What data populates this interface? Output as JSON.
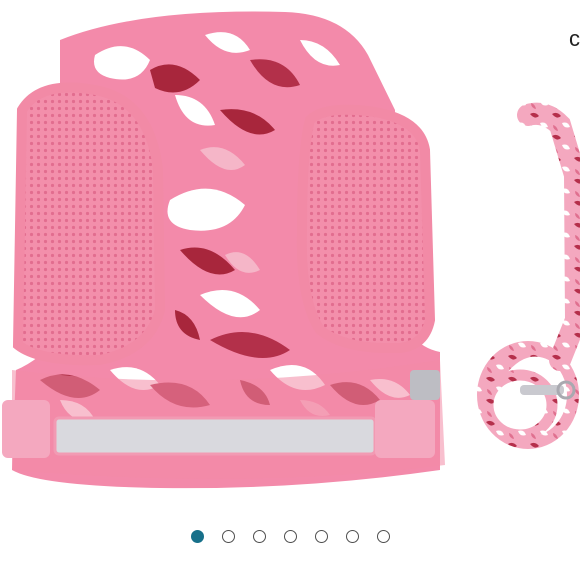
{
  "viewer": {
    "image_icon": "dog-harness-product-image",
    "edge_text": "c",
    "carousel": {
      "count": 7,
      "active_index": 0,
      "active_color": "#17708a",
      "inactive_border": "#4f4f4f"
    }
  },
  "colors": {
    "harness_pink": "#f07aa0",
    "binding_pink": "#f27da4",
    "mesh_pink": "#f28ea8",
    "camo_light": "#f5b6c8",
    "camo_dark": "#a8263c",
    "reflective_strip": "#d9d9de"
  }
}
